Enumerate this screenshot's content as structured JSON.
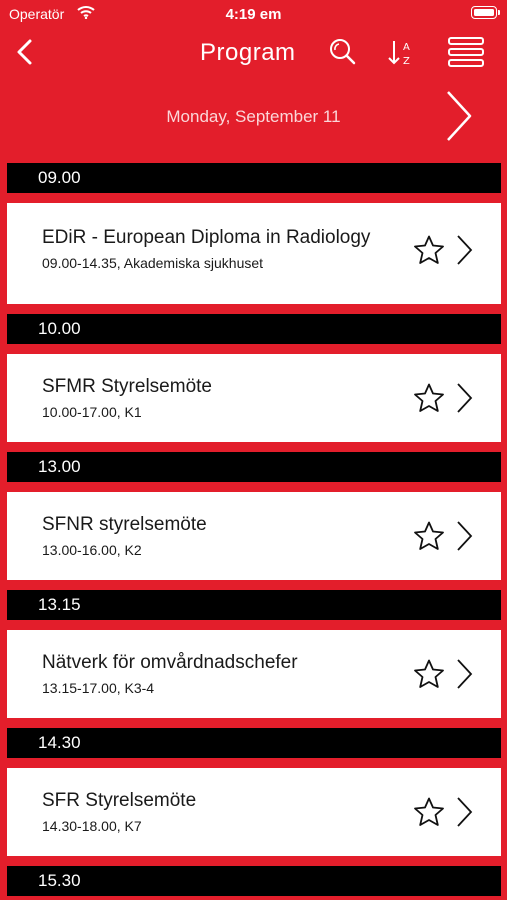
{
  "status_bar": {
    "carrier": "Operatör",
    "time": "4:19 em"
  },
  "navbar": {
    "title": "Program",
    "icons": [
      "back-icon",
      "search-icon",
      "sort-az-icon",
      "menu-icon"
    ]
  },
  "date_bar": {
    "label": "Monday, September 11"
  },
  "colors": {
    "brand_red": "#e31e2b",
    "section_black": "#000000",
    "card_white": "#ffffff"
  },
  "sections": [
    {
      "time": "09.00",
      "events": [
        {
          "title": "EDiR - European Diploma in Radiology",
          "subtitle": "09.00-14.35, Akademiska sjukhuset"
        }
      ]
    },
    {
      "time": "10.00",
      "events": [
        {
          "title": "SFMR Styrelsemöte",
          "subtitle": "10.00-17.00, K1"
        }
      ]
    },
    {
      "time": "13.00",
      "events": [
        {
          "title": "SFNR styrelsemöte",
          "subtitle": "13.00-16.00, K2"
        }
      ]
    },
    {
      "time": "13.15",
      "events": [
        {
          "title": "Nätverk för omvårdnadschefer",
          "subtitle": "13.15-17.00, K3-4"
        }
      ]
    },
    {
      "time": "14.30",
      "events": [
        {
          "title": "SFR Styrelsemöte",
          "subtitle": "14.30-18.00, K7"
        }
      ]
    },
    {
      "time": "15.30",
      "events": []
    }
  ]
}
